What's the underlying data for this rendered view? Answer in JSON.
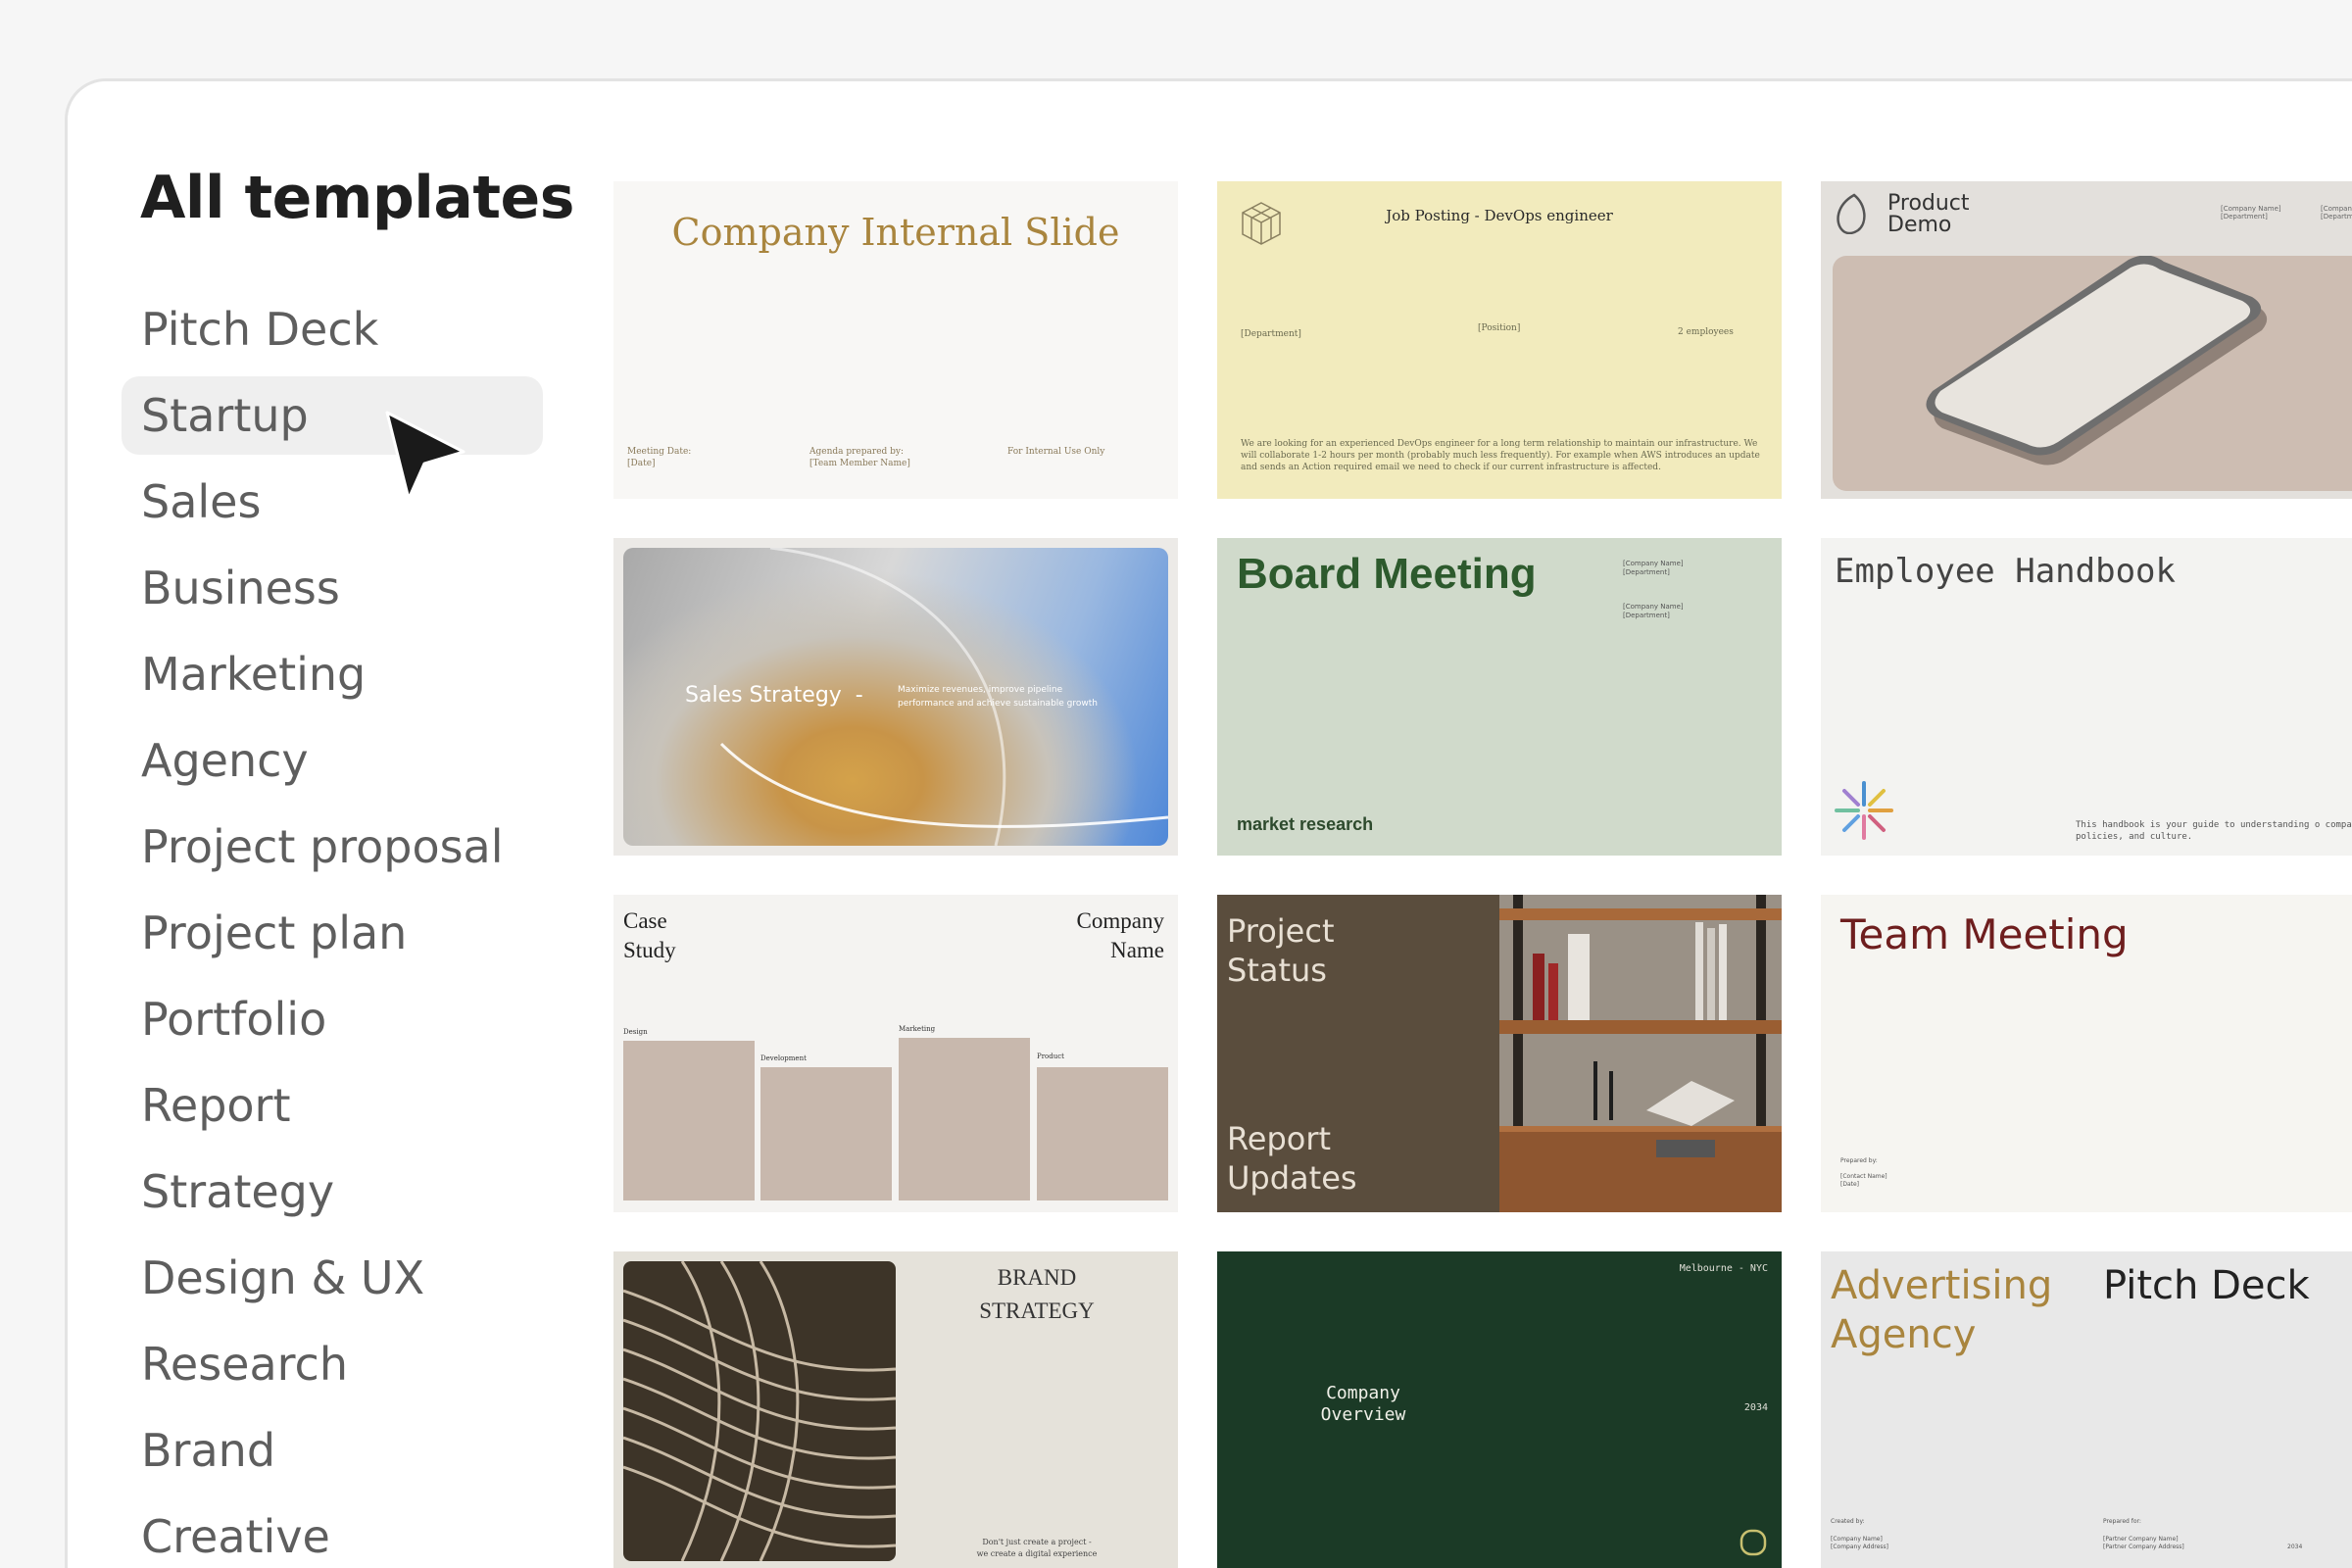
{
  "page": {
    "title": "All templates"
  },
  "categories": [
    {
      "label": "Pitch Deck"
    },
    {
      "label": "Startup",
      "active": true
    },
    {
      "label": "Sales"
    },
    {
      "label": "Business"
    },
    {
      "label": "Marketing"
    },
    {
      "label": "Agency"
    },
    {
      "label": "Project proposal"
    },
    {
      "label": "Project plan"
    },
    {
      "label": "Portfolio"
    },
    {
      "label": "Report"
    },
    {
      "label": "Strategy"
    },
    {
      "label": "Design & UX"
    },
    {
      "label": "Research"
    },
    {
      "label": "Brand"
    },
    {
      "label": "Creative"
    }
  ],
  "templates": {
    "company_internal": {
      "title": "Company Internal Slide",
      "meeting_date": "Meeting Date:",
      "date": "[Date]",
      "agenda": "Agenda prepared by:",
      "member": "[Team Member Name]",
      "internal": "For Internal Use Only"
    },
    "job_posting": {
      "title": "Job Posting - DevOps engineer",
      "department": "[Department]",
      "position": "[Position]",
      "employees": "2 employees",
      "body": "We are looking for an experienced DevOps engineer for a long term relationship to maintain our infrastructure. We will collaborate 1-2 hours per month (probably much less frequently). For example when AWS introduces an update and sends an Action required email we need to check if our current infrastructure is affected."
    },
    "product_demo": {
      "title_line1": "Product",
      "title_line2": "Demo",
      "company": "[Company Name]",
      "department": "[Department]",
      "company2": "[Company",
      "department2": "[Departme"
    },
    "sales_strategy": {
      "title": "Sales Strategy  -",
      "subtitle": "Maximize revenues, improve pipeline performance and achieve sustainable growth"
    },
    "board_meeting": {
      "title": "Board Meeting",
      "company1": "[Company Name]",
      "dept1": "[Department]",
      "company2": "[Company Name]",
      "dept2": "[Department]",
      "footer": "market research"
    },
    "employee_handbook": {
      "title": "Employee Handbook",
      "body": "This handbook is your guide to understanding o company, policies, and culture."
    },
    "case_study": {
      "title_line1": "Case",
      "title_line2": "Study",
      "company_line1": "Company",
      "company_line2": "Name",
      "bars": [
        {
          "label": "Design"
        },
        {
          "label": "Development"
        },
        {
          "label": "Marketing"
        },
        {
          "label": "Product"
        }
      ]
    },
    "project_status": {
      "title_line1": "Project",
      "title_line2": "Status",
      "sub_line1": "Report",
      "sub_line2": "Updates"
    },
    "team_meeting": {
      "title": "Team Meeting",
      "prepared": "Prepared by:",
      "contact": "[Contact Name]",
      "date": "[Date]"
    },
    "brand_strategy": {
      "title_line1": "BRAND",
      "title_line2": "STRATEGY",
      "tagline1": "Don't just create a project -",
      "tagline2": "we create a digital experience"
    },
    "company_overview": {
      "location": "Melbourne - NYC",
      "title_line1": "Company",
      "title_line2": "Overview",
      "year": "2034"
    },
    "advertising_agency": {
      "title_line1": "Advertising",
      "title_line2": "Agency",
      "pitch": "Pitch Deck",
      "created_by": "Created by:",
      "company_name": "[Company Name]",
      "company_address": "[Company Address]",
      "prepared_for": "Prepared for:",
      "partner_name": "[Partner Company Name]",
      "partner_address": "[Partner Company Address]",
      "year": "2034"
    }
  },
  "colors": {
    "gold": "#a9853e",
    "board_green": "#2d5a2d",
    "team_red": "#6e1e1e",
    "dark_green": "#1b3a26",
    "olive_brown": "#5a4d3d"
  },
  "icons": {
    "cursor": "arrow-cursor-icon",
    "cube": "cube-logo-icon",
    "leaf": "leaf-logo-icon",
    "asterisk": "color-asterisk-icon",
    "ring": "ring-icon"
  }
}
